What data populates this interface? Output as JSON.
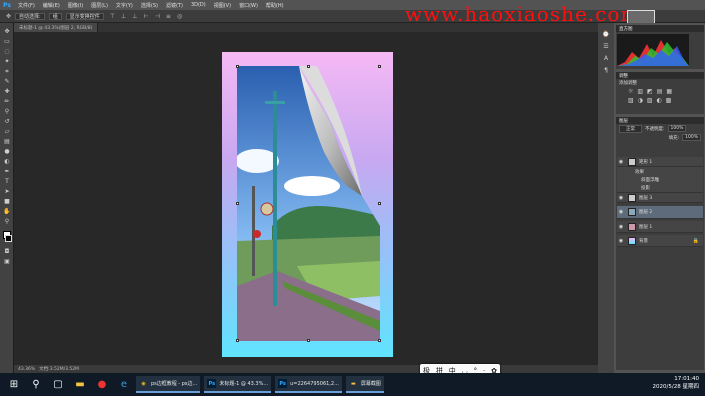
{
  "menu": {
    "items": [
      "文件(F)",
      "编辑(E)",
      "图像(I)",
      "图层(L)",
      "文字(Y)",
      "选择(S)",
      "滤镜(T)",
      "3D(D)",
      "视图(V)",
      "窗口(W)",
      "帮助(H)"
    ],
    "ps_label": "Ps"
  },
  "watermark": {
    "text": "www.haoxiaoshe.com"
  },
  "options": {
    "auto_select": "自动选择:",
    "group": "组",
    "show_transform": "显示变换控件"
  },
  "tabs": [
    "未标题-1 @ 43.3%(图层 2, RGB/8)"
  ],
  "status": {
    "zoom": "43.36%",
    "doc": "文档:3.52M/3.52M"
  },
  "panels": {
    "histogram_title": "直方图",
    "adjust_title": "调整",
    "adjust_sub": "添加调整",
    "layers_title": "图层",
    "blend_mode": "正常",
    "opacity_label": "不透明度:",
    "opacity": "100%",
    "fill_label": "填充:",
    "fill": "100%",
    "layers": [
      {
        "name": "矩形 1",
        "selected": false
      },
      {
        "name": "效果",
        "selected": false
      },
      {
        "name": "斜面浮雕",
        "selected": false
      },
      {
        "name": "投影",
        "selected": false
      },
      {
        "name": "图层 3",
        "selected": false
      },
      {
        "name": "图层 2",
        "selected": true
      },
      {
        "name": "图层 1",
        "selected": false
      },
      {
        "name": "背景",
        "selected": false
      }
    ]
  },
  "taskbar": {
    "apps": [
      {
        "label": "ps边框教程 - ps边...",
        "icon": "chrome-icon"
      },
      {
        "label": "未标题-1 @ 43.3%...",
        "icon": "photoshop-icon"
      },
      {
        "label": "u=2264795061,2...",
        "icon": "photoshop-icon"
      },
      {
        "label": "屏幕截图",
        "icon": "folder-icon"
      }
    ],
    "time": "17:01:40",
    "date": "2020/5/28 星期四"
  },
  "ime": {
    "items": [
      "极",
      "拼",
      "中",
      "◡",
      "°",
      "·",
      "✿"
    ]
  }
}
